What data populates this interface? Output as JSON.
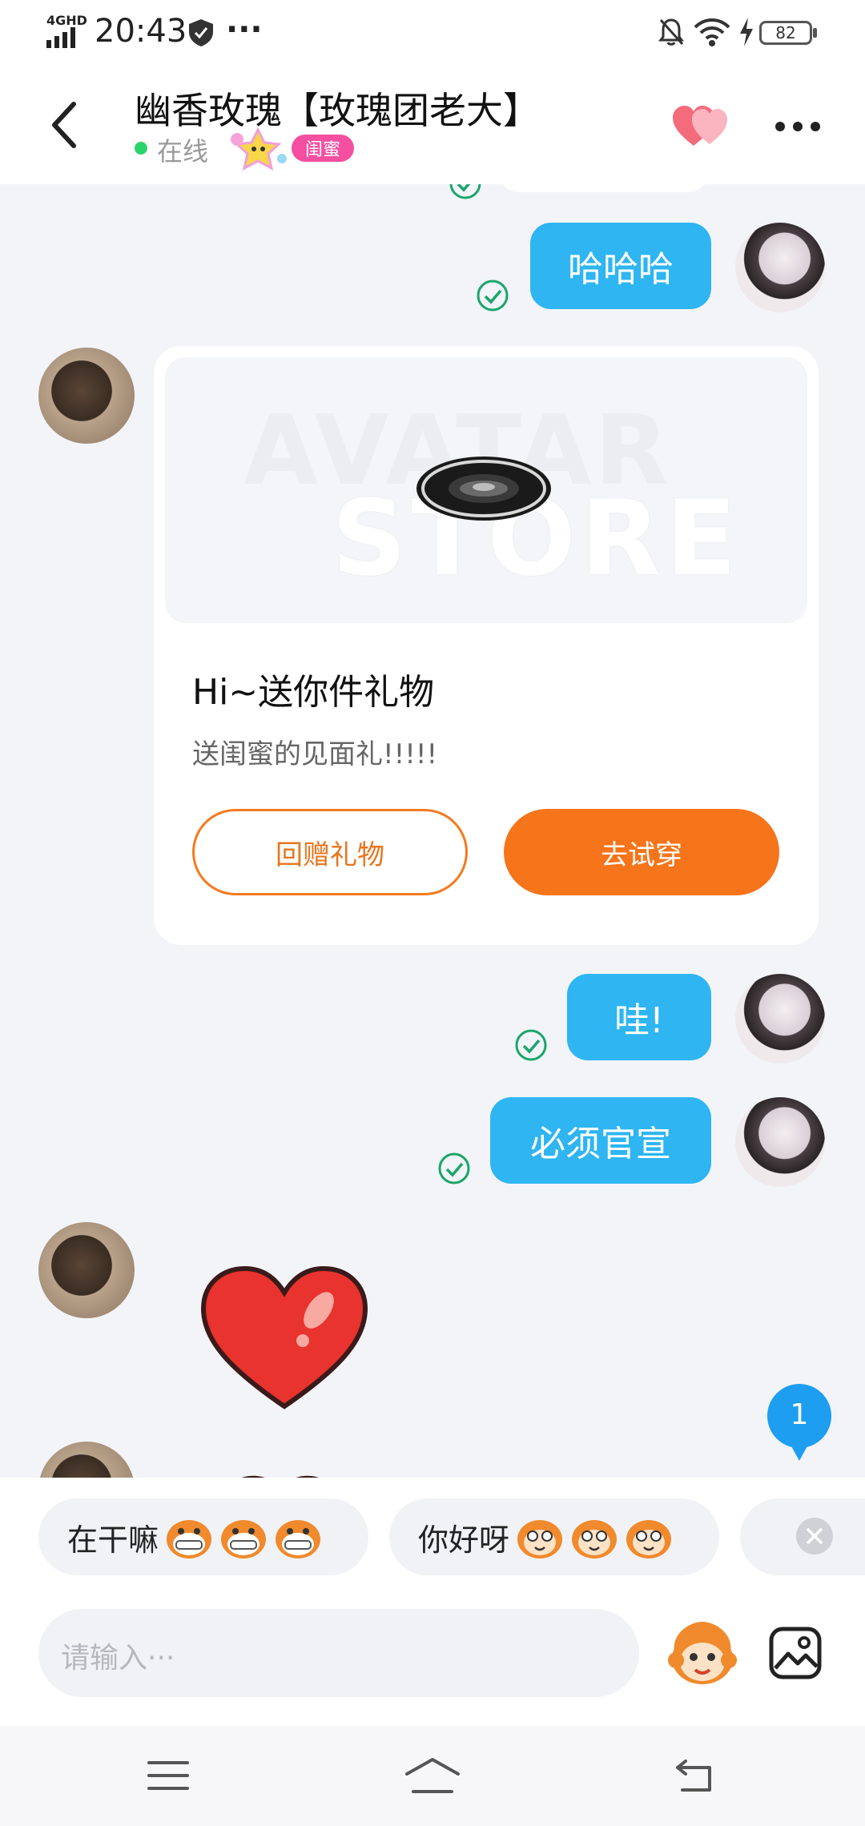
{
  "status": {
    "network": "4GHD",
    "time": "20:43",
    "dots": "···",
    "battery": "82"
  },
  "header": {
    "title": "幽香玫瑰【玫瑰团老大】",
    "online": "在线",
    "badge": "闺蜜"
  },
  "messages": {
    "m1": "哈哈哈",
    "m2": "哇!",
    "m3": "必须官宣"
  },
  "gift_card": {
    "watermark_line1": "AVATAR",
    "watermark_line2": "STORE",
    "title": "Hi~送你件礼物",
    "text": "送闺蜜的见面礼!!!!!",
    "return_btn": "回赠礼物",
    "try_btn": "去试穿"
  },
  "unread_count": "1",
  "quick_replies": [
    {
      "text": "在干嘛"
    },
    {
      "text": "你好呀"
    }
  ],
  "input": {
    "placeholder": "请输入···"
  },
  "colors": {
    "bubble": "#2eb5f2",
    "accent": "#f6741a",
    "check": "#1aa56b"
  }
}
